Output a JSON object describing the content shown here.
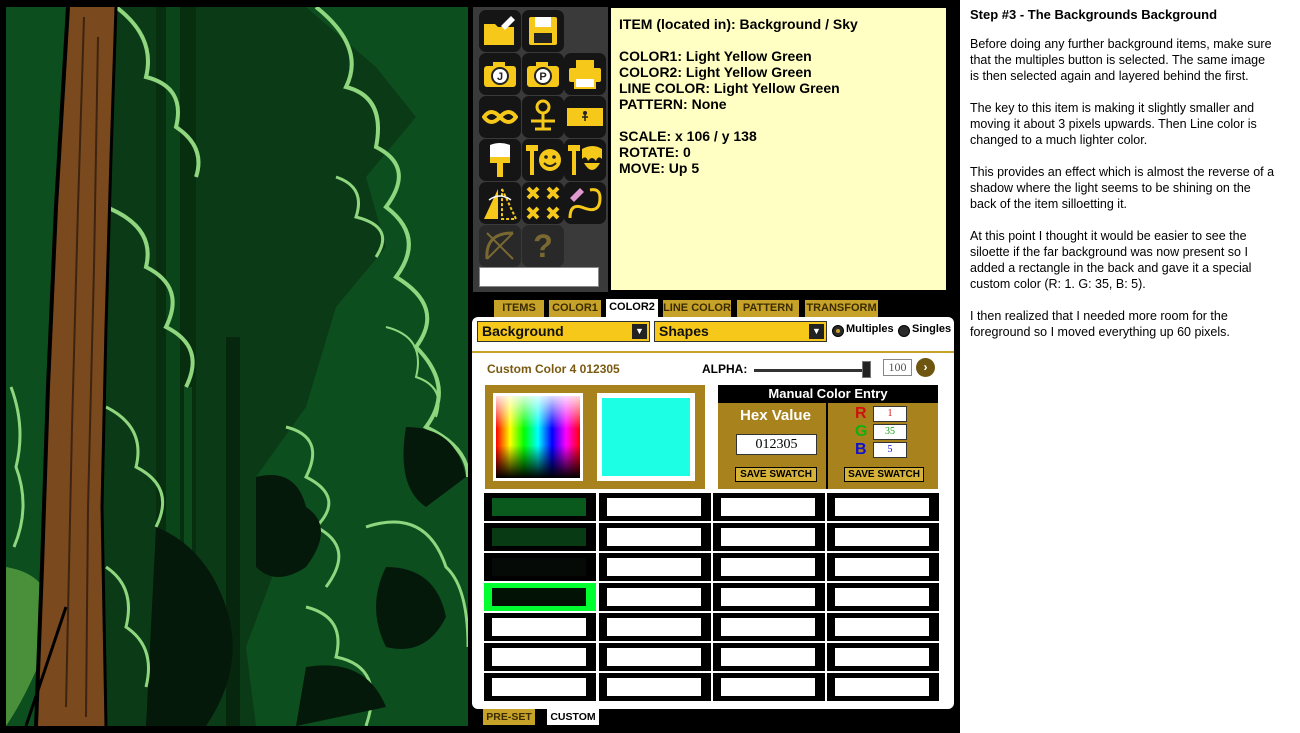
{
  "tools": {
    "items": [
      {
        "name": "open-icon"
      },
      {
        "name": "save-icon"
      },
      {
        "name": "jpg-camera-icon",
        "letter": "J"
      },
      {
        "name": "png-camera-icon",
        "letter": "P"
      },
      {
        "name": "print-icon"
      },
      {
        "name": "mask-icon"
      },
      {
        "name": "character-icon"
      },
      {
        "name": "banner-icon"
      },
      {
        "name": "brush-icon"
      },
      {
        "name": "face-icon"
      },
      {
        "name": "beard-icon"
      },
      {
        "name": "mirror-icon"
      },
      {
        "name": "crosses-icon"
      },
      {
        "name": "draw-icon"
      },
      {
        "name": "bow-icon"
      },
      {
        "name": "help-icon",
        "glyph": "?"
      }
    ]
  },
  "info": {
    "item": "ITEM (located in): Background / Sky",
    "color1": "COLOR1: Light Yellow Green",
    "color2": "COLOR2: Light Yellow Green",
    "line_color": "LINE COLOR: Light Yellow Green",
    "pattern": "PATTERN: None",
    "scale": "SCALE: x 106 / y 138",
    "rotate": "ROTATE: 0",
    "move": "MOVE: Up 5"
  },
  "tabs": [
    "ITEMS",
    "COLOR1",
    "COLOR2",
    "LINE COLOR",
    "PATTERN",
    "TRANSFORM"
  ],
  "active_tab": "COLOR2",
  "panel": {
    "category": "Background",
    "subcategory": "Shapes",
    "radio_multiples": "Multiples",
    "radio_singles": "Singles",
    "color_name": "Custom Color 4 012305",
    "alpha_label": "ALPHA:",
    "alpha_value": "100",
    "manual_title": "Manual Color Entry",
    "hex_label": "Hex Value",
    "hex_value": "012305",
    "r_label": "R",
    "g_label": "G",
    "b_label": "B",
    "r_value": "1",
    "g_value": "35",
    "b_value": "5",
    "save_swatch_1": "SAVE SWATCH",
    "save_swatch_2": "SAVE SWATCH",
    "preview_color": "#1dffe5"
  },
  "swatch_colors": [
    "#0a5a1e",
    "#083a14",
    "#050a07",
    "#021306"
  ],
  "bottom_tabs": [
    "PRE-SET",
    "CUSTOM"
  ],
  "description": {
    "title": "Step #3 - The Backgrounds Background",
    "p1": "Before doing any further background items, make sure that the multiples button is selected. The same image is then selected again and layered behind the first.",
    "p2": "The key to this item is making it slightly smaller and moving it about 3 pixels upwards. Then Line color is changed to a much lighter color.",
    "p3": "This provides an effect which is almost the reverse of a shadow where the light seems to be shining on the back of the item silloetting it.",
    "p4": "At this point I thought it would be easier to see the siloette if the far background was now present so I added a rectangle in the back and gave it a special custom color (R: 1. G: 35, B: 5).",
    "p5": "I then realized that I needed more room for the foreground so I moved everything up 60 pixels."
  },
  "colors": {
    "gold": "#c7a228",
    "dark_gold": "#a8821c",
    "info_bg": "#ffffc4",
    "forest_dark": "#0d3d18",
    "tree_trunk": "#7a4a1e",
    "outline_light": "#8fd67f"
  }
}
